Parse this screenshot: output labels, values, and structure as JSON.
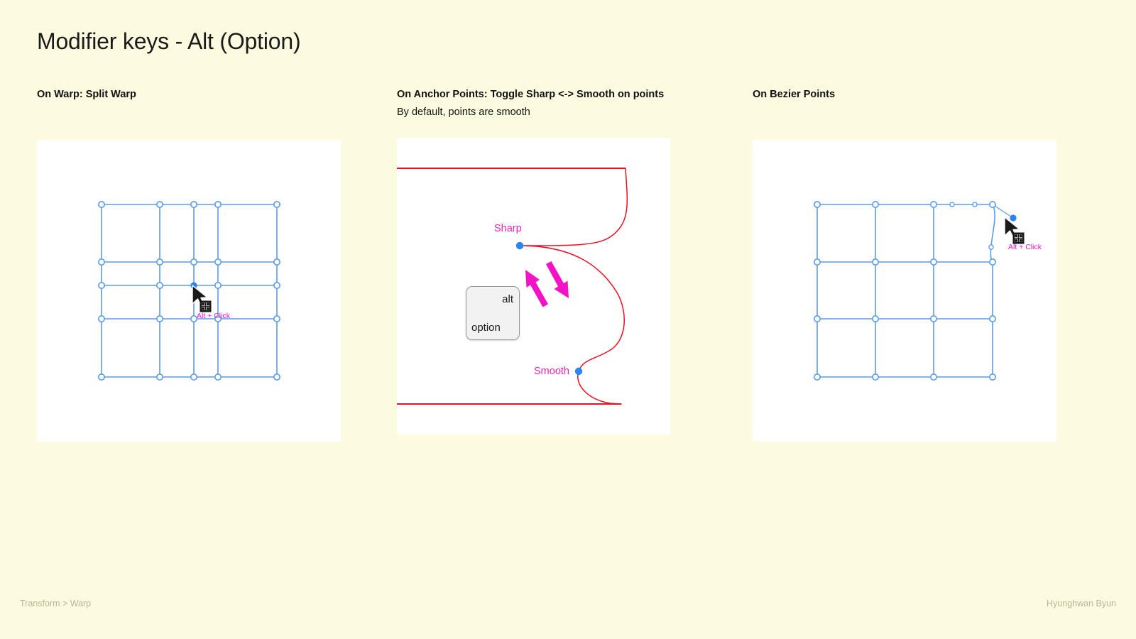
{
  "page": {
    "title": "Modifier keys - Alt (Option)",
    "background_color": "#FDFBDF"
  },
  "columns": [
    {
      "id": "warp",
      "heading": "On Warp: Split Warp",
      "subheading": "",
      "callout": "Alt + Click",
      "cursor_icon": "split-grid-cursor-icon"
    },
    {
      "id": "anchor-points",
      "heading": "On Anchor Points: Toggle Sharp <-> Smooth on points",
      "subheading": "By default, points are smooth",
      "labels": {
        "sharp": "Sharp",
        "smooth": "Smooth"
      },
      "keycap": {
        "top_label": "alt",
        "bottom_label": "option"
      },
      "arrow_icon": "double-arrow-toggle-icon"
    },
    {
      "id": "bezier-points",
      "heading": "On Bezier Points",
      "subheading": "",
      "callout": "Alt + Click",
      "cursor_icon": "split-grid-cursor-icon"
    }
  ],
  "footer": {
    "left": "Transform > Warp",
    "right": "Hyunghwan Byun"
  },
  "colors": {
    "accent_magenta": "#ED23B8",
    "curve_red": "#E81123",
    "grid_blue": "#5A9BEC",
    "anchor_blue": "#2A85F0",
    "panel_white": "#FFFFFF",
    "footer_text": "#B9B49A"
  }
}
